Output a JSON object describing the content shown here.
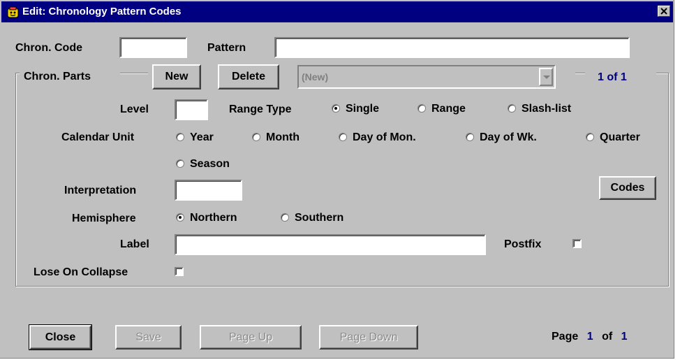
{
  "window": {
    "title": "Edit: Chronology Pattern Codes"
  },
  "header": {
    "chron_code_label": "Chron. Code",
    "chron_code_value": "",
    "pattern_label": "Pattern",
    "pattern_value": ""
  },
  "chron_parts": {
    "group_label": "Chron. Parts",
    "new_button": "New",
    "delete_button": "Delete",
    "selector_value": "(New)",
    "counter": "1 of 1",
    "level_label": "Level",
    "level_value": "",
    "range_type_label": "Range Type",
    "range_types": [
      {
        "label": "Single",
        "selected": true
      },
      {
        "label": "Range",
        "selected": false
      },
      {
        "label": "Slash-list",
        "selected": false
      }
    ],
    "calendar_unit_label": "Calendar Unit",
    "calendar_units": [
      {
        "label": "Year",
        "selected": false
      },
      {
        "label": "Month",
        "selected": false
      },
      {
        "label": "Day of Mon.",
        "selected": false
      },
      {
        "label": "Day of Wk.",
        "selected": false
      },
      {
        "label": "Quarter",
        "selected": false
      },
      {
        "label": "Season",
        "selected": false
      }
    ],
    "interpretation_label": "Interpretation",
    "interpretation_value": "",
    "codes_button": "Codes",
    "hemisphere_label": "Hemisphere",
    "hemispheres": [
      {
        "label": "Northern",
        "selected": true
      },
      {
        "label": "Southern",
        "selected": false
      }
    ],
    "label_label": "Label",
    "label_value": "",
    "postfix_label": "Postfix",
    "postfix_checked": false,
    "lose_on_collapse_label": "Lose On Collapse",
    "lose_on_collapse_checked": false
  },
  "footer": {
    "close_button": "Close",
    "save_button": "Save",
    "page_up_button": "Page Up",
    "page_down_button": "Page Down",
    "page_label": "Page",
    "page_current": "1",
    "of_label": "of",
    "page_total": "1"
  },
  "colors": {
    "titlebar": "#000080",
    "face": "#c0c0c0",
    "accent_text": "#000080"
  }
}
